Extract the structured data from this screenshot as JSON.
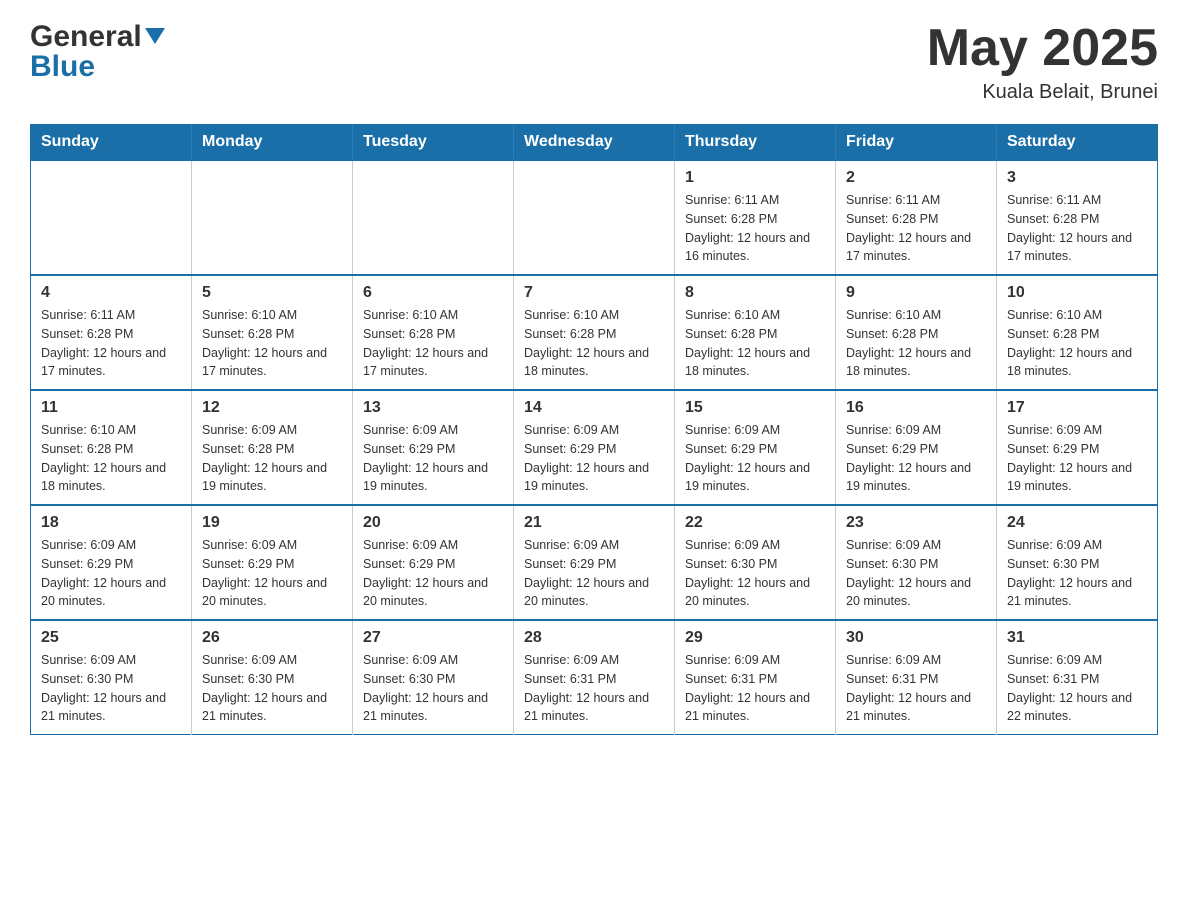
{
  "header": {
    "logo_general": "General",
    "logo_blue": "Blue",
    "title": "May 2025",
    "subtitle": "Kuala Belait, Brunei"
  },
  "days_of_week": [
    "Sunday",
    "Monday",
    "Tuesday",
    "Wednesday",
    "Thursday",
    "Friday",
    "Saturday"
  ],
  "weeks": [
    [
      {
        "day": "",
        "info": ""
      },
      {
        "day": "",
        "info": ""
      },
      {
        "day": "",
        "info": ""
      },
      {
        "day": "",
        "info": ""
      },
      {
        "day": "1",
        "info": "Sunrise: 6:11 AM\nSunset: 6:28 PM\nDaylight: 12 hours and 16 minutes."
      },
      {
        "day": "2",
        "info": "Sunrise: 6:11 AM\nSunset: 6:28 PM\nDaylight: 12 hours and 17 minutes."
      },
      {
        "day": "3",
        "info": "Sunrise: 6:11 AM\nSunset: 6:28 PM\nDaylight: 12 hours and 17 minutes."
      }
    ],
    [
      {
        "day": "4",
        "info": "Sunrise: 6:11 AM\nSunset: 6:28 PM\nDaylight: 12 hours and 17 minutes."
      },
      {
        "day": "5",
        "info": "Sunrise: 6:10 AM\nSunset: 6:28 PM\nDaylight: 12 hours and 17 minutes."
      },
      {
        "day": "6",
        "info": "Sunrise: 6:10 AM\nSunset: 6:28 PM\nDaylight: 12 hours and 17 minutes."
      },
      {
        "day": "7",
        "info": "Sunrise: 6:10 AM\nSunset: 6:28 PM\nDaylight: 12 hours and 18 minutes."
      },
      {
        "day": "8",
        "info": "Sunrise: 6:10 AM\nSunset: 6:28 PM\nDaylight: 12 hours and 18 minutes."
      },
      {
        "day": "9",
        "info": "Sunrise: 6:10 AM\nSunset: 6:28 PM\nDaylight: 12 hours and 18 minutes."
      },
      {
        "day": "10",
        "info": "Sunrise: 6:10 AM\nSunset: 6:28 PM\nDaylight: 12 hours and 18 minutes."
      }
    ],
    [
      {
        "day": "11",
        "info": "Sunrise: 6:10 AM\nSunset: 6:28 PM\nDaylight: 12 hours and 18 minutes."
      },
      {
        "day": "12",
        "info": "Sunrise: 6:09 AM\nSunset: 6:28 PM\nDaylight: 12 hours and 19 minutes."
      },
      {
        "day": "13",
        "info": "Sunrise: 6:09 AM\nSunset: 6:29 PM\nDaylight: 12 hours and 19 minutes."
      },
      {
        "day": "14",
        "info": "Sunrise: 6:09 AM\nSunset: 6:29 PM\nDaylight: 12 hours and 19 minutes."
      },
      {
        "day": "15",
        "info": "Sunrise: 6:09 AM\nSunset: 6:29 PM\nDaylight: 12 hours and 19 minutes."
      },
      {
        "day": "16",
        "info": "Sunrise: 6:09 AM\nSunset: 6:29 PM\nDaylight: 12 hours and 19 minutes."
      },
      {
        "day": "17",
        "info": "Sunrise: 6:09 AM\nSunset: 6:29 PM\nDaylight: 12 hours and 19 minutes."
      }
    ],
    [
      {
        "day": "18",
        "info": "Sunrise: 6:09 AM\nSunset: 6:29 PM\nDaylight: 12 hours and 20 minutes."
      },
      {
        "day": "19",
        "info": "Sunrise: 6:09 AM\nSunset: 6:29 PM\nDaylight: 12 hours and 20 minutes."
      },
      {
        "day": "20",
        "info": "Sunrise: 6:09 AM\nSunset: 6:29 PM\nDaylight: 12 hours and 20 minutes."
      },
      {
        "day": "21",
        "info": "Sunrise: 6:09 AM\nSunset: 6:29 PM\nDaylight: 12 hours and 20 minutes."
      },
      {
        "day": "22",
        "info": "Sunrise: 6:09 AM\nSunset: 6:30 PM\nDaylight: 12 hours and 20 minutes."
      },
      {
        "day": "23",
        "info": "Sunrise: 6:09 AM\nSunset: 6:30 PM\nDaylight: 12 hours and 20 minutes."
      },
      {
        "day": "24",
        "info": "Sunrise: 6:09 AM\nSunset: 6:30 PM\nDaylight: 12 hours and 21 minutes."
      }
    ],
    [
      {
        "day": "25",
        "info": "Sunrise: 6:09 AM\nSunset: 6:30 PM\nDaylight: 12 hours and 21 minutes."
      },
      {
        "day": "26",
        "info": "Sunrise: 6:09 AM\nSunset: 6:30 PM\nDaylight: 12 hours and 21 minutes."
      },
      {
        "day": "27",
        "info": "Sunrise: 6:09 AM\nSunset: 6:30 PM\nDaylight: 12 hours and 21 minutes."
      },
      {
        "day": "28",
        "info": "Sunrise: 6:09 AM\nSunset: 6:31 PM\nDaylight: 12 hours and 21 minutes."
      },
      {
        "day": "29",
        "info": "Sunrise: 6:09 AM\nSunset: 6:31 PM\nDaylight: 12 hours and 21 minutes."
      },
      {
        "day": "30",
        "info": "Sunrise: 6:09 AM\nSunset: 6:31 PM\nDaylight: 12 hours and 21 minutes."
      },
      {
        "day": "31",
        "info": "Sunrise: 6:09 AM\nSunset: 6:31 PM\nDaylight: 12 hours and 22 minutes."
      }
    ]
  ]
}
